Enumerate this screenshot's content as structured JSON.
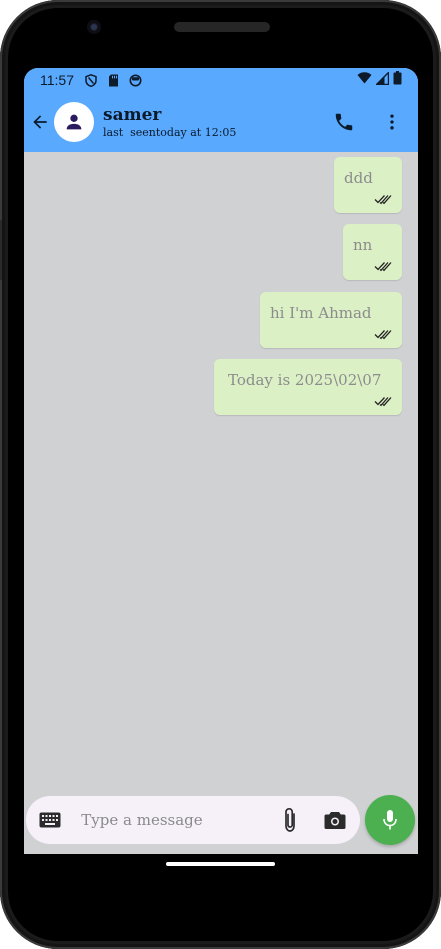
{
  "status_bar": {
    "time": "11:57",
    "icons_left": [
      "shield-icon",
      "sd-card-icon",
      "sync-icon"
    ],
    "icons_right": [
      "wifi-icon",
      "signal-icon",
      "battery-icon"
    ]
  },
  "header": {
    "contact_name": "samer",
    "last_seen": "last  seentoday at 12:05",
    "background_color": "#59a9ff"
  },
  "messages": [
    {
      "text": "ddd",
      "status": "read"
    },
    {
      "text": "nn",
      "status": "read"
    },
    {
      "text": "hi I'm Ahmad",
      "status": "read"
    },
    {
      "text": "Today is 2025\\02\\07",
      "status": "read"
    }
  ],
  "composer": {
    "placeholder": "Type a message",
    "value": ""
  },
  "colors": {
    "chat_background": "#d0d1d3",
    "bubble": "#dcf0c6",
    "mic_button": "#4caf50",
    "composer_background": "#f6f0f8"
  }
}
